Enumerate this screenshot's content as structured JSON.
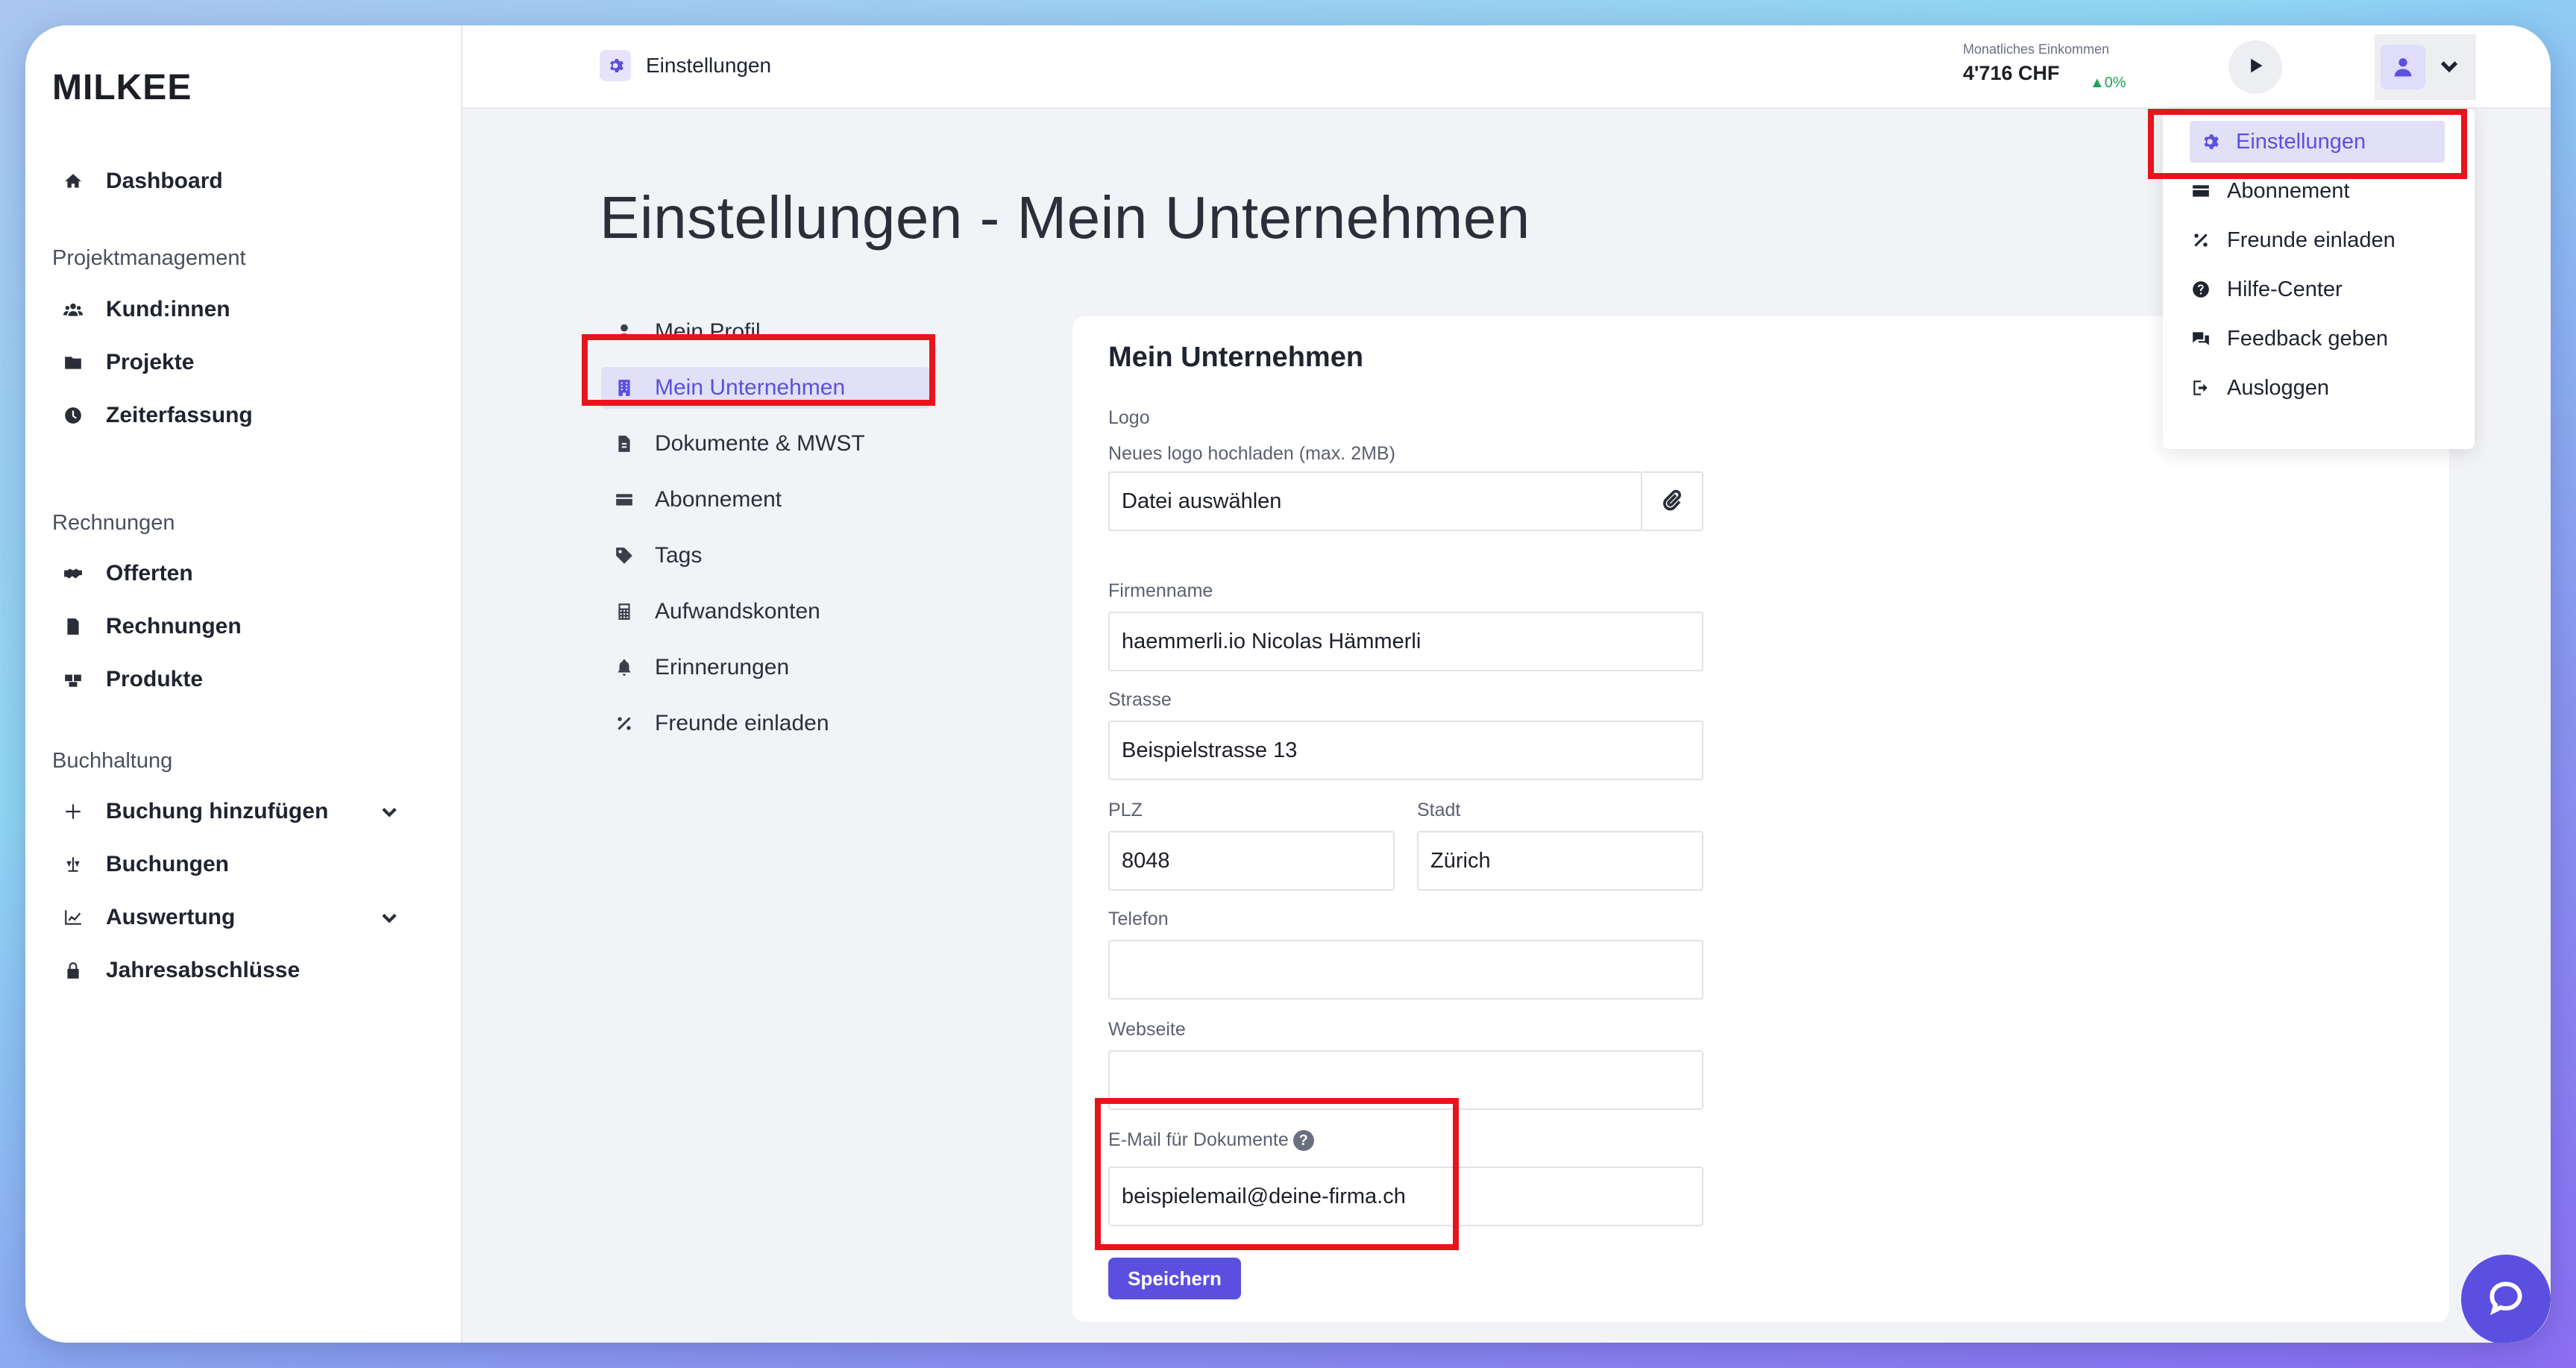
{
  "app": {
    "logo": "MILKEE"
  },
  "sidebar": {
    "dashboard": "Dashboard",
    "section_projekt": "Projektmanagement",
    "kunden": "Kund:innen",
    "projekte": "Projekte",
    "zeiterfassung": "Zeiterfassung",
    "section_rechnungen": "Rechnungen",
    "offerten": "Offerten",
    "rechnungen": "Rechnungen",
    "produkte": "Produkte",
    "section_buchhaltung": "Buchhaltung",
    "buchung_hinzufuegen": "Buchung hinzufügen",
    "buchungen": "Buchungen",
    "auswertung": "Auswertung",
    "jahresabschluesse": "Jahresabschlüsse"
  },
  "topbar": {
    "breadcrumb": "Einstellungen",
    "income_label": "Monatliches Einkommen",
    "income_value": "4'716 CHF",
    "income_change": "▲0%"
  },
  "page": {
    "title": "Einstellungen - Mein Unternehmen"
  },
  "settings_nav": {
    "mein_profil": "Mein Profil",
    "mein_unternehmen": "Mein Unternehmen",
    "dokumente": "Dokumente & MWST",
    "abonnement": "Abonnement",
    "tags": "Tags",
    "aufwandskonten": "Aufwandskonten",
    "erinnerungen": "Erinnerungen",
    "freunde": "Freunde einladen"
  },
  "form": {
    "title": "Mein Unternehmen",
    "logo_label": "Logo",
    "logo_sublabel": "Neues logo hochladen (max. 2MB)",
    "file_placeholder": "Datei auswählen",
    "firmenname_label": "Firmenname",
    "firmenname_value": "haemmerli.io Nicolas Hämmerli",
    "strasse_label": "Strasse",
    "strasse_value": "Beispielstrasse 13",
    "plz_label": "PLZ",
    "plz_value": "8048",
    "stadt_label": "Stadt",
    "stadt_value": "Zürich",
    "telefon_label": "Telefon",
    "telefon_value": "",
    "webseite_label": "Webseite",
    "webseite_value": "",
    "email_label": "E-Mail für Dokumente",
    "email_value": "beispielemail@deine-firma.ch",
    "save_label": "Speichern"
  },
  "dropdown": {
    "einstellungen": "Einstellungen",
    "abonnement": "Abonnement",
    "freunde": "Freunde einladen",
    "hilfe": "Hilfe-Center",
    "feedback": "Feedback geben",
    "ausloggen": "Ausloggen"
  },
  "colors": {
    "accent": "#5b4fe0",
    "highlight": "#e8141b",
    "positive": "#20a15c"
  }
}
